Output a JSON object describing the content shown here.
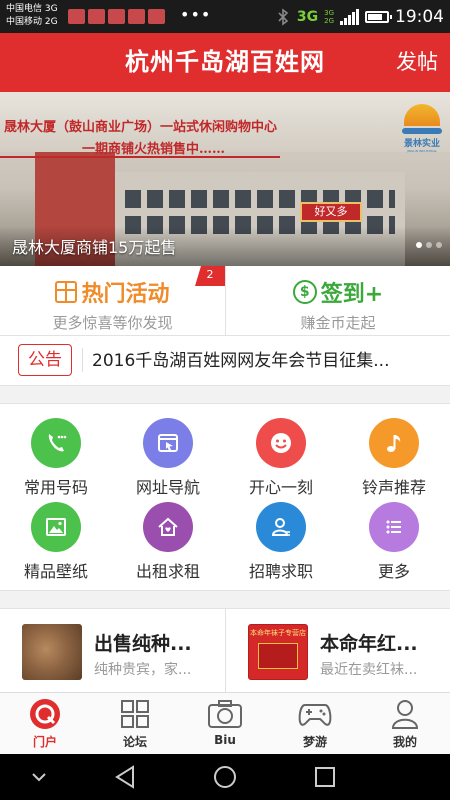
{
  "status_bar": {
    "carrier1": "中国电信 3G",
    "carrier2": "中国移动 2G",
    "more": "•••",
    "network": "3G",
    "signal_label_top": "3G",
    "signal_label_bottom": "2G",
    "time": "19:04"
  },
  "header": {
    "title": "杭州千岛湖百姓网",
    "post_button": "发帖"
  },
  "banner": {
    "slogan_line1": "晟林大厦（鼓山商业广场）一站式休闲购物中心",
    "slogan_line2": "一期商铺火热销售中……",
    "logo_text": "景林实业",
    "logo_subtext": "JINGLIN INDUSTRIAL",
    "store_sign": "好又多",
    "caption": "晟林大厦商铺15万起售",
    "page_count": 3,
    "active_page": 1
  },
  "activity": {
    "hot": {
      "title": "热门活动",
      "subtitle": "更多惊喜等你发现",
      "badge": "2",
      "color": "#f08b2a"
    },
    "checkin": {
      "title": "签到+",
      "subtitle": "赚金币走起",
      "color": "#3aa83a"
    }
  },
  "notice": {
    "tag": "公告",
    "text": "2016千岛湖百姓网网友年会节目征集..."
  },
  "grid": {
    "items": [
      {
        "label": "常用号码",
        "icon": "phone-icon",
        "color": "#4cc24c"
      },
      {
        "label": "网址导航",
        "icon": "browser-icon",
        "color": "#7a7ee6"
      },
      {
        "label": "开心一刻",
        "icon": "smile-icon",
        "color": "#ef4c4c"
      },
      {
        "label": "铃声推荐",
        "icon": "music-note-icon",
        "color": "#f59a2a"
      },
      {
        "label": "精品壁纸",
        "icon": "image-icon",
        "color": "#4cc24c"
      },
      {
        "label": "出租求租",
        "icon": "house-icon",
        "color": "#9a4fae"
      },
      {
        "label": "招聘求职",
        "icon": "person-icon",
        "color": "#2a8ad8"
      },
      {
        "label": "更多",
        "icon": "list-icon",
        "color": "#b77be0"
      }
    ]
  },
  "ads": [
    {
      "title": "出售纯种...",
      "subtitle": "纯种贵宾，家..."
    },
    {
      "title": "本命年红...",
      "subtitle": "最近在卖红袜...",
      "thumb_text": "本命年袜子专营店"
    }
  ],
  "tabbar": {
    "items": [
      {
        "label": "门户",
        "icon": "portal-icon",
        "active": true
      },
      {
        "label": "论坛",
        "icon": "grid-icon",
        "active": false
      },
      {
        "label": "Biu",
        "icon": "camera-icon",
        "active": false
      },
      {
        "label": "梦游",
        "icon": "gamepad-icon",
        "active": false
      },
      {
        "label": "我的",
        "icon": "user-icon",
        "active": false
      }
    ]
  }
}
